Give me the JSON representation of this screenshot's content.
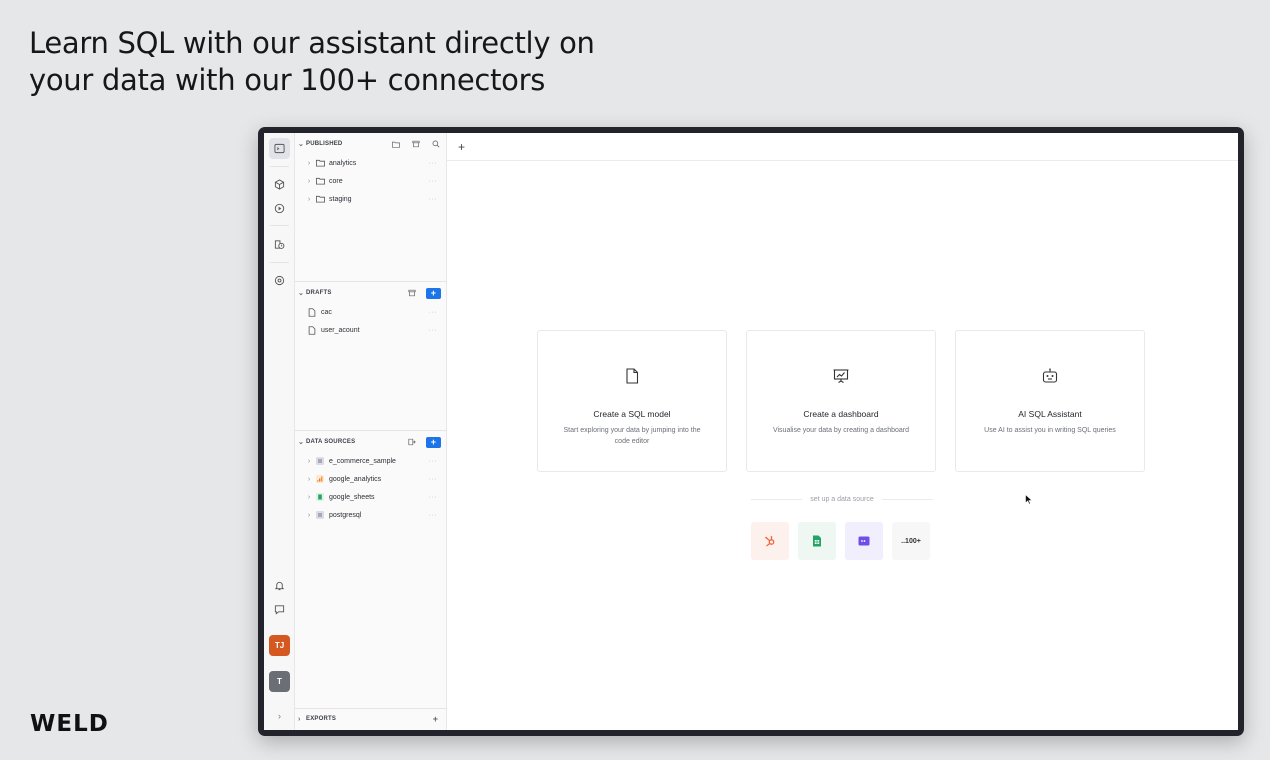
{
  "headline": {
    "line1": "Learn SQL with our assistant directly on",
    "line2": "your data with our 100+ connectors"
  },
  "brand": "WELD",
  "rail": {
    "icons": [
      "terminal-icon",
      "cube-icon",
      "play-icon",
      "history-icon",
      "settings-icon",
      "bell-icon",
      "chat-icon",
      "expand-icon"
    ],
    "avatar_user": "TJ",
    "avatar_workspace": "T",
    "avatar_user_color": "#d4581f",
    "avatar_workspace_color": "#6b6e74"
  },
  "sidebar": {
    "published": {
      "title": "PUBLISHED",
      "items": [
        "analytics",
        "core",
        "staging"
      ],
      "more": "···"
    },
    "drafts": {
      "title": "DRAFTS",
      "add": "+",
      "items": [
        "cac",
        "user_acount"
      ],
      "more": "···"
    },
    "data_sources": {
      "title": "DATA SOURCES",
      "add": "+",
      "items": [
        "e_commerce_sample",
        "google_analytics",
        "google_sheets",
        "postgresql"
      ],
      "more": "···"
    },
    "exports": {
      "title": "EXPORTS",
      "add": "+"
    }
  },
  "main": {
    "new_tab": "+",
    "cards": [
      {
        "title": "Create a SQL model",
        "desc": "Start exploring your data by jumping into the code editor",
        "icon": "file-icon"
      },
      {
        "title": "Create a dashboard",
        "desc": "Visualise your data by creating a dashboard",
        "icon": "presentation-chart-icon"
      },
      {
        "title": "AI SQL Assistant",
        "desc": "Use AI to assist you in writing SQL queries",
        "icon": "robot-icon"
      }
    ],
    "datasource_label": "set up a data source",
    "connectors": [
      {
        "name": "hubspot-icon",
        "bg": "#fdf1ee",
        "color": "#f0643b"
      },
      {
        "name": "google-sheets-icon",
        "bg": "#eef7f1",
        "color": "#21a464"
      },
      {
        "name": "chat-widget-icon",
        "bg": "#f1effd",
        "color": "#6e4ee6"
      },
      {
        "name": "more-connectors",
        "label": "..100+",
        "bg": "#f7f7f8"
      }
    ]
  },
  "colors": {
    "accent": "#1b74e8",
    "background": "#e6e7e9"
  }
}
